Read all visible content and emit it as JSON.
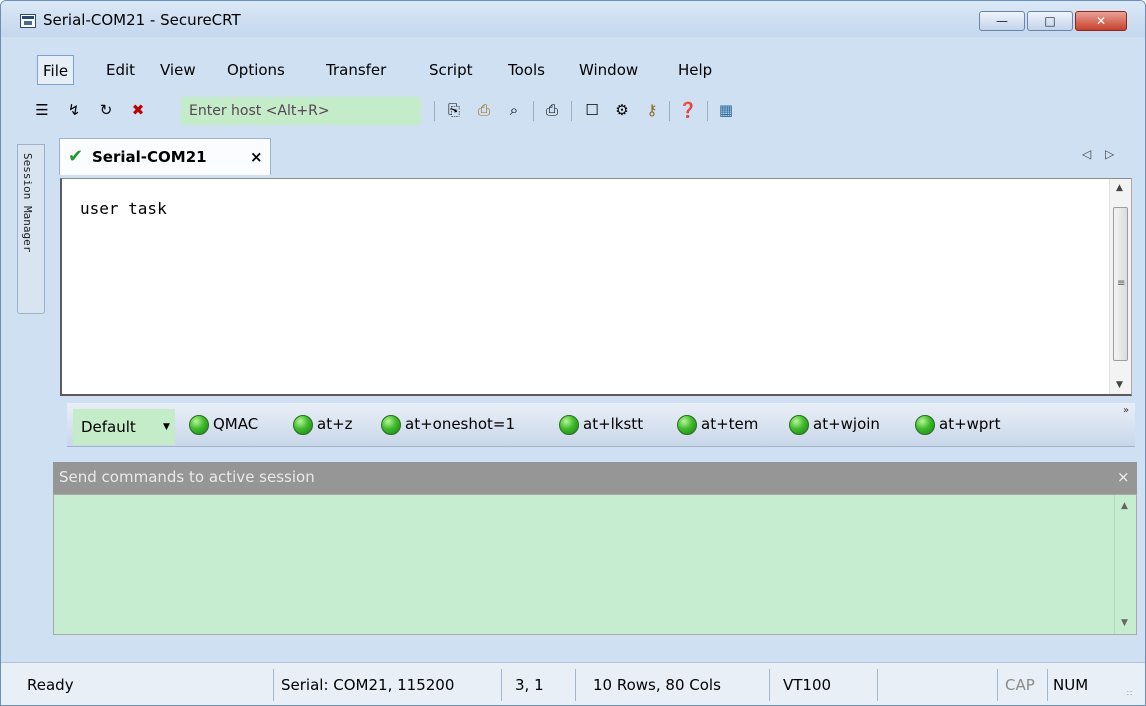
{
  "window": {
    "title": "Serial-COM21 - SecureCRT",
    "min_glyph": "—",
    "max_glyph": "□",
    "close_glyph": "✕"
  },
  "menu": {
    "items": [
      {
        "label": "File"
      },
      {
        "label": "Edit"
      },
      {
        "label": "View"
      },
      {
        "label": "Options"
      },
      {
        "label": "Transfer"
      },
      {
        "label": "Script"
      },
      {
        "label": "Tools"
      },
      {
        "label": "Window"
      },
      {
        "label": "Help"
      }
    ]
  },
  "toolbar": {
    "host_placeholder": "Enter host <Alt+R>",
    "icons": [
      "connect-icon",
      "quick-connect-icon",
      "reconnect-icon",
      "disconnect-icon",
      "copy-icon",
      "paste-icon",
      "find-icon",
      "print-icon",
      "session-options-icon",
      "global-options-icon",
      "keymap-icon",
      "help-icon",
      "sftp-icon"
    ]
  },
  "sidebar": {
    "session_manager_label": "Session Manager"
  },
  "tabs": [
    {
      "label": "Serial-COM21",
      "close": "×",
      "status": "connected"
    }
  ],
  "tab_nav": {
    "left": "◁",
    "right": "▷"
  },
  "terminal": {
    "lines": [
      "user task"
    ]
  },
  "button_bar": {
    "selected": "Default",
    "buttons": [
      {
        "label": "QMAC"
      },
      {
        "label": "at+z"
      },
      {
        "label": "at+oneshot=1"
      },
      {
        "label": "at+lkstt"
      },
      {
        "label": "at+tem"
      },
      {
        "label": "at+wjoin"
      },
      {
        "label": "at+wprt"
      }
    ]
  },
  "command_window": {
    "title": "Send commands to active session",
    "close": "×",
    "value": ""
  },
  "status_bar": {
    "status": "Ready",
    "connection": "Serial: COM21, 115200",
    "cursor": "3,  1",
    "size": "10 Rows, 80 Cols",
    "emulation": "VT100",
    "cap": "CAP",
    "num": "NUM"
  },
  "colors": {
    "title_bg": "#c4d7ee",
    "input_green": "#c5ecc9",
    "command_area_bg": "#c6edcf",
    "command_header_bg": "#969696",
    "led_green": "#3dbb2a",
    "close_red": "#c7422e"
  }
}
